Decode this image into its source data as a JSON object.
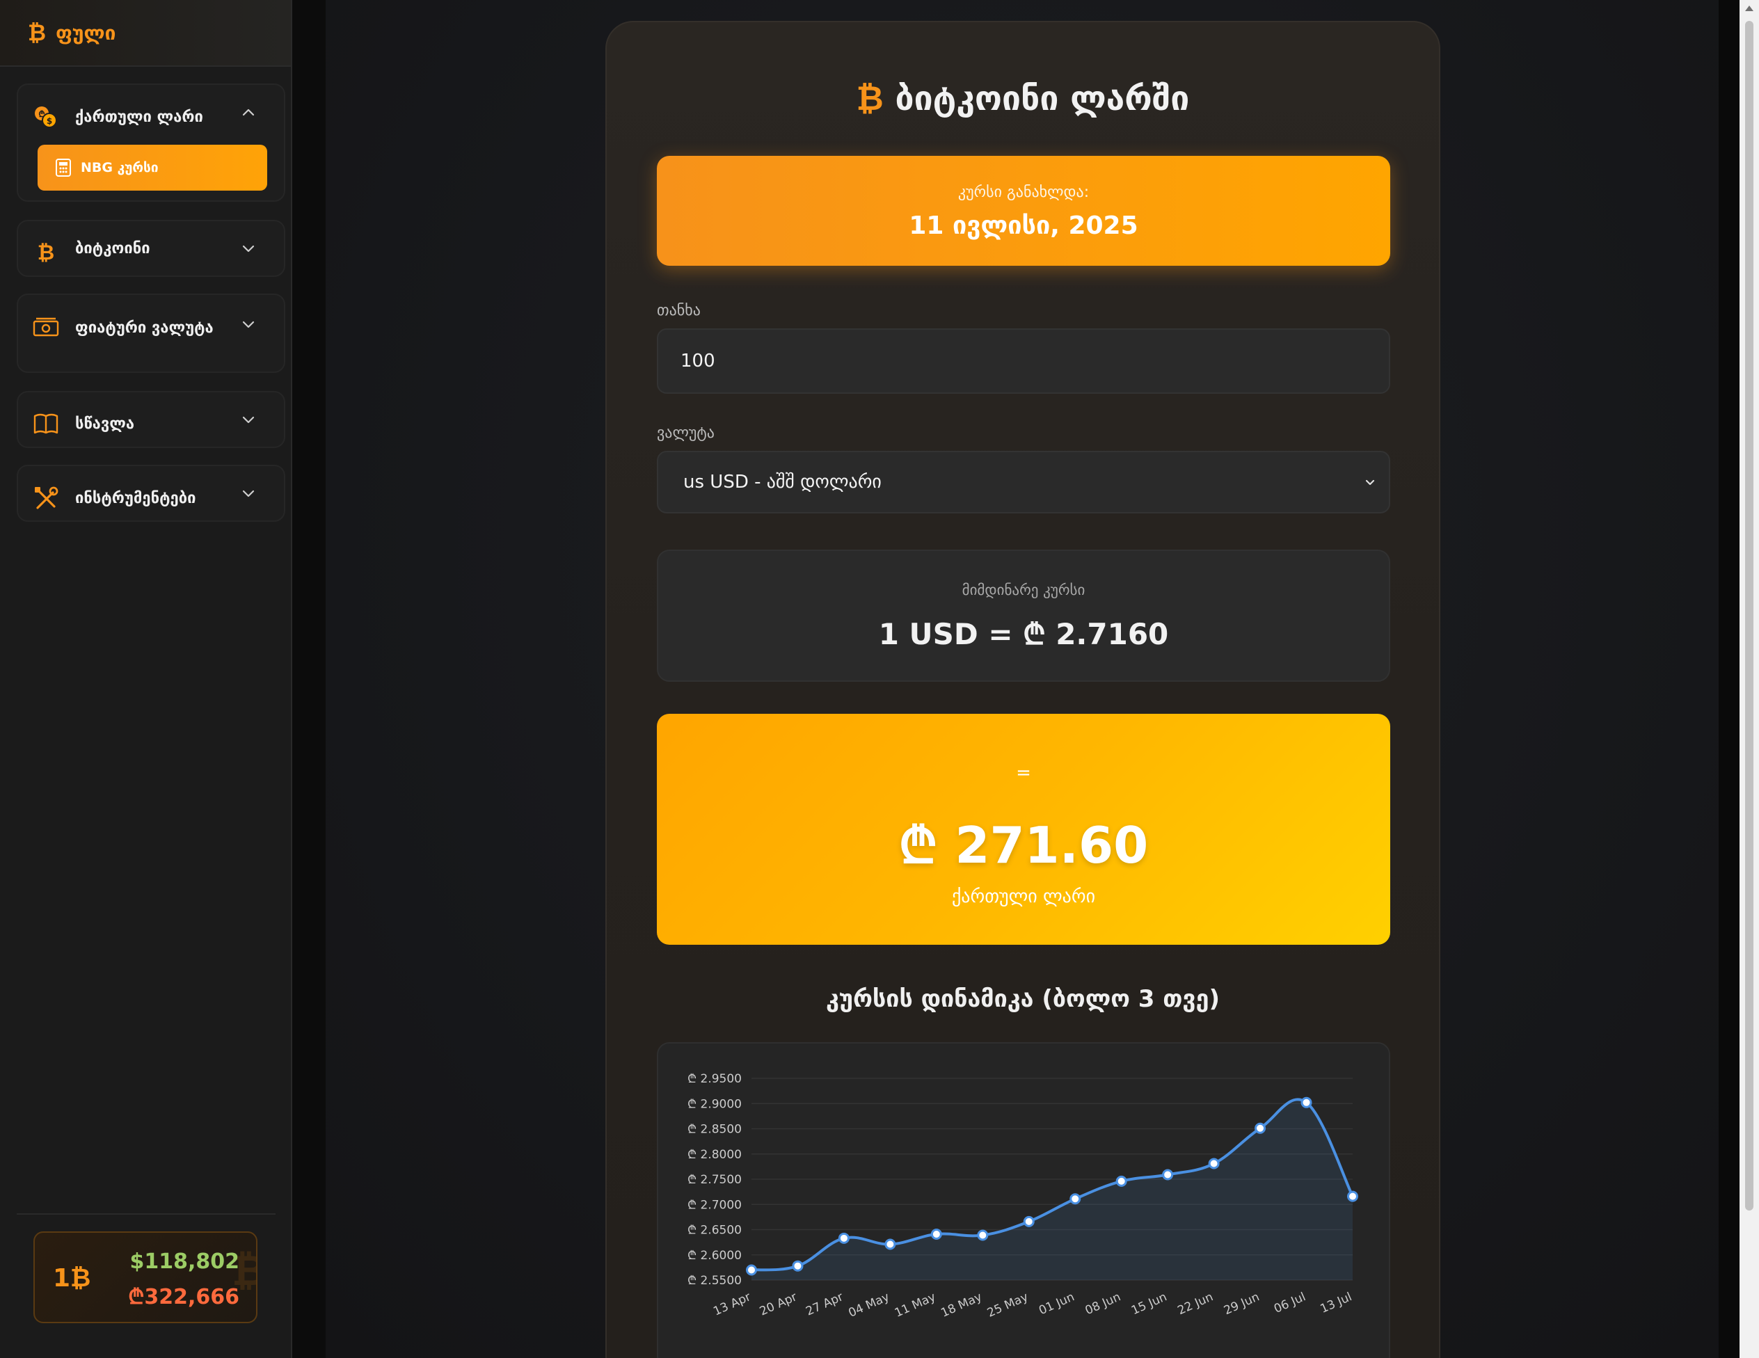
{
  "sidebar": {
    "brand": {
      "icon": "bitcoin-icon",
      "symbol": "₿",
      "label": "ფული"
    },
    "groups": [
      {
        "icon": "coins-icon",
        "label": "ქართული ლარი",
        "expanded": true,
        "items": [
          {
            "icon": "calculator-icon",
            "label": "NBG კურსი",
            "active": true
          }
        ]
      },
      {
        "icon": "bitcoin-icon",
        "symbol": "₿",
        "label": "ბიტკოინი",
        "expanded": false
      },
      {
        "icon": "banknote-icon",
        "label": "ფიატური ვალუტა",
        "expanded": false
      },
      {
        "icon": "book-icon",
        "label": "სწავლა",
        "expanded": false
      },
      {
        "icon": "tools-icon",
        "label": "ინსტრუმენტები",
        "expanded": false
      }
    ],
    "ticker": {
      "unit": "1₿",
      "usd": "$118,802",
      "gel": "₾322,666",
      "ghost": "₿"
    }
  },
  "converter": {
    "title_symbol": "₿",
    "title": "ბიტკოინი ლარში",
    "updated_label": "კურსი განახლდა:",
    "updated_date": "11 ივლისი, 2025",
    "amount_label": "თანხა",
    "amount_value": "100",
    "currency_label": "ვალუტა",
    "currency_selected": "us USD - აშშ დოლარი",
    "rate_label": "მიმდინარე კურსი",
    "rate_value": "1 USD = ₾ 2.7160",
    "equals": "=",
    "result_amount": "₾ 271.60",
    "result_currency": "ქართული ლარი",
    "chart_title": "კურსის დინამიკა (ბოლო 3 თვე)"
  },
  "colors": {
    "accent": "#f7931a",
    "line": "#4a90e2",
    "ticker_usd": "#9ccc65",
    "ticker_gel": "#ff6a3d"
  },
  "chart_data": {
    "type": "line",
    "categories": [
      "13 Apr",
      "20 Apr",
      "27 Apr",
      "04 May",
      "11 May",
      "18 May",
      "25 May",
      "01 Jun",
      "08 Jun",
      "15 Jun",
      "22 Jun",
      "29 Jun",
      "06 Jul",
      "13 Jul"
    ],
    "values": [
      2.57,
      2.578,
      2.633,
      2.621,
      2.641,
      2.639,
      2.666,
      2.711,
      2.746,
      2.759,
      2.781,
      2.851,
      2.902,
      2.716
    ],
    "ylim": [
      2.55,
      2.95
    ],
    "yticks": [
      "₾ 2.9500",
      "₾ 2.9000",
      "₾ 2.8500",
      "₾ 2.8000",
      "₾ 2.7500",
      "₾ 2.7000",
      "₾ 2.6500",
      "₾ 2.6000",
      "₾ 2.5500"
    ],
    "ytick_values": [
      2.95,
      2.9,
      2.85,
      2.8,
      2.75,
      2.7,
      2.65,
      2.6,
      2.55
    ],
    "title": "",
    "xlabel": "",
    "ylabel": "",
    "grid": true,
    "fill": true,
    "legend": false
  }
}
